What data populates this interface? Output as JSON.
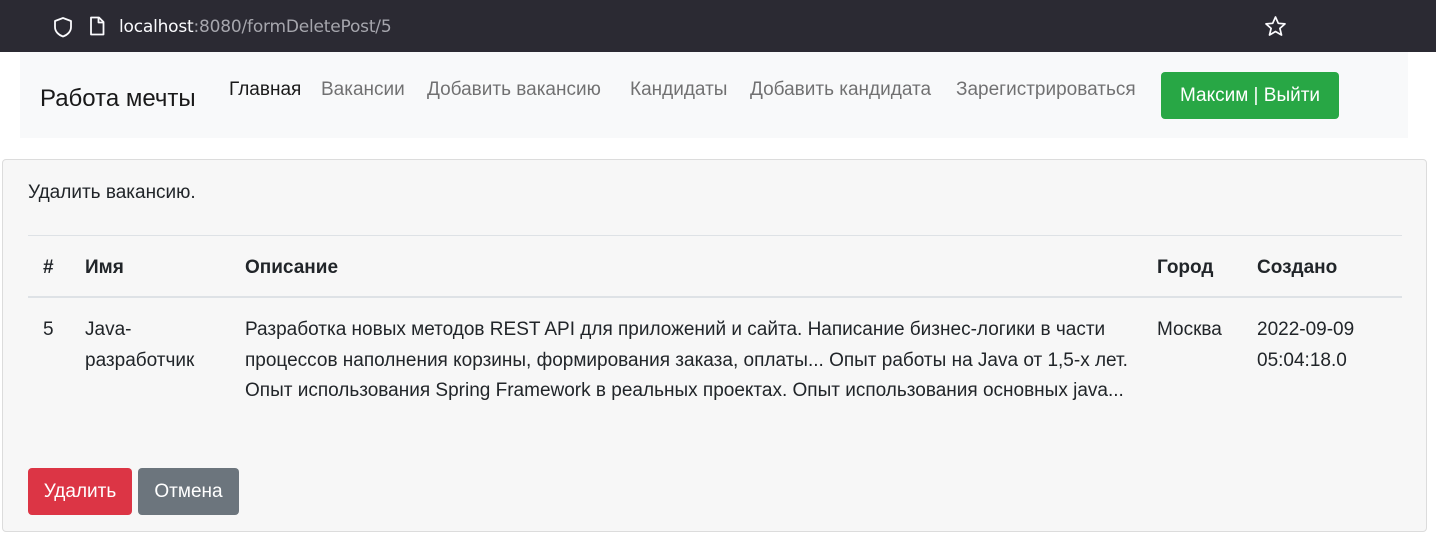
{
  "browser": {
    "url_host": "localhost",
    "url_rest": ":8080/formDeletePost/5",
    "icons": [
      "shield-icon",
      "page-icon",
      "star-icon"
    ]
  },
  "navbar": {
    "brand": "Работа мечты",
    "links": [
      {
        "label": "Главная",
        "active": true
      },
      {
        "label": "Вакансии",
        "active": false
      },
      {
        "label": "Добавить вакансию",
        "active": false
      },
      {
        "label": "Кандидаты",
        "active": false
      },
      {
        "label": "Добавить кандидата",
        "active": false
      },
      {
        "label": "Зарегистрироваться",
        "active": false
      }
    ],
    "user_button": "Максим | Выйти"
  },
  "card": {
    "title": "Удалить вакансию.",
    "table": {
      "headers": [
        "#",
        "Имя",
        "Описание",
        "Город",
        "Создано"
      ],
      "rows": [
        {
          "num": "5",
          "name": "Java-разработчик",
          "description": "Разработка новых методов REST API для приложений и сайта. Написание бизнес-логики в части процессов наполнения корзины, формирования заказа, оплаты... Опыт работы на Java от 1,5-х лет. Опыт использования Spring Framework в реальных проектах. Опыт использования основных java...",
          "city": "Москва",
          "created": "2022-09-09 05:04:18.0"
        }
      ]
    },
    "delete_button": "Удалить",
    "cancel_button": "Отмена"
  },
  "colors": {
    "browser_bar": "#2b2a33",
    "navbar_bg": "#f8f9fa",
    "success": "#28a745",
    "danger": "#dc3545",
    "secondary": "#6c757d"
  }
}
